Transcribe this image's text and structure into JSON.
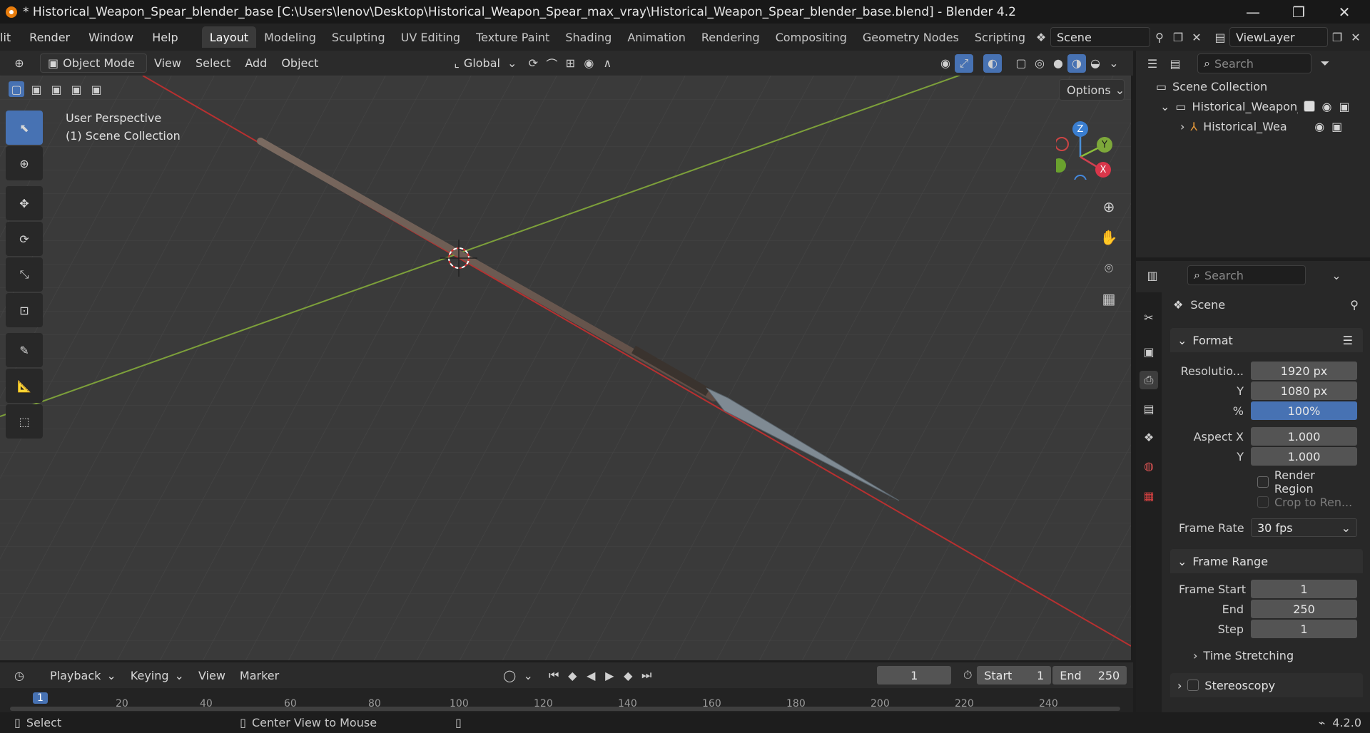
{
  "titlebar": {
    "title": "* Historical_Weapon_Spear_blender_base [C:\\Users\\lenov\\Desktop\\Historical_Weapon_Spear_max_vray\\Historical_Weapon_Spear_blender_base.blend] - Blender 4.2",
    "minimize": "—",
    "restore": "❐",
    "close": "✕"
  },
  "menubar": {
    "menus": [
      "lit",
      "Render",
      "Window",
      "Help"
    ],
    "workspaces": [
      "Layout",
      "Modeling",
      "Sculpting",
      "UV Editing",
      "Texture Paint",
      "Shading",
      "Animation",
      "Rendering",
      "Compositing",
      "Geometry Nodes",
      "Scripting"
    ],
    "scene": "Scene",
    "view_layer": "ViewLayer"
  },
  "viewport_header": {
    "mode": "Object Mode",
    "menus": [
      "View",
      "Select",
      "Add",
      "Object"
    ],
    "transform": "Global",
    "options": "Options"
  },
  "viewport": {
    "perspective": "User Perspective",
    "collection": "(1) Scene Collection",
    "gizmo": {
      "z": "Z",
      "y": "Y",
      "x": "X"
    }
  },
  "outliner": {
    "search_placeholder": "Search",
    "root": "Scene Collection",
    "collection": "Historical_Weapon_",
    "object": "Historical_Wea"
  },
  "properties": {
    "search_placeholder": "Search",
    "context": "Scene",
    "format": {
      "title": "Format",
      "resolution_label": "Resolutio...",
      "res_x": "1920 px",
      "y_label": "Y",
      "res_y": "1080 px",
      "pct_label": "%",
      "pct": "100%",
      "aspect_label": "Aspect X",
      "aspect_x": "1.000",
      "aspect_y_label": "Y",
      "aspect_y": "1.000",
      "render_region": "Render Region",
      "crop": "Crop to Ren...",
      "frame_rate_label": "Frame Rate",
      "frame_rate": "30 fps"
    },
    "frame_range": {
      "title": "Frame Range",
      "start_label": "Frame Start",
      "start": "1",
      "end_label": "End",
      "end": "250",
      "step_label": "Step",
      "step": "1"
    },
    "time_stretching": "Time Stretching",
    "stereoscopy": "Stereoscopy"
  },
  "timeline": {
    "menus": [
      "Playback",
      "Keying",
      "View",
      "Marker"
    ],
    "current_frame": "1",
    "start_label": "Start",
    "start": "1",
    "end_label": "End",
    "end": "250",
    "ticks": [
      "1",
      "20",
      "40",
      "60",
      "80",
      "100",
      "120",
      "140",
      "160",
      "180",
      "200",
      "220",
      "240"
    ]
  },
  "statusbar": {
    "select": "Select",
    "center": "Center View to Mouse",
    "version": "4.2.0"
  }
}
